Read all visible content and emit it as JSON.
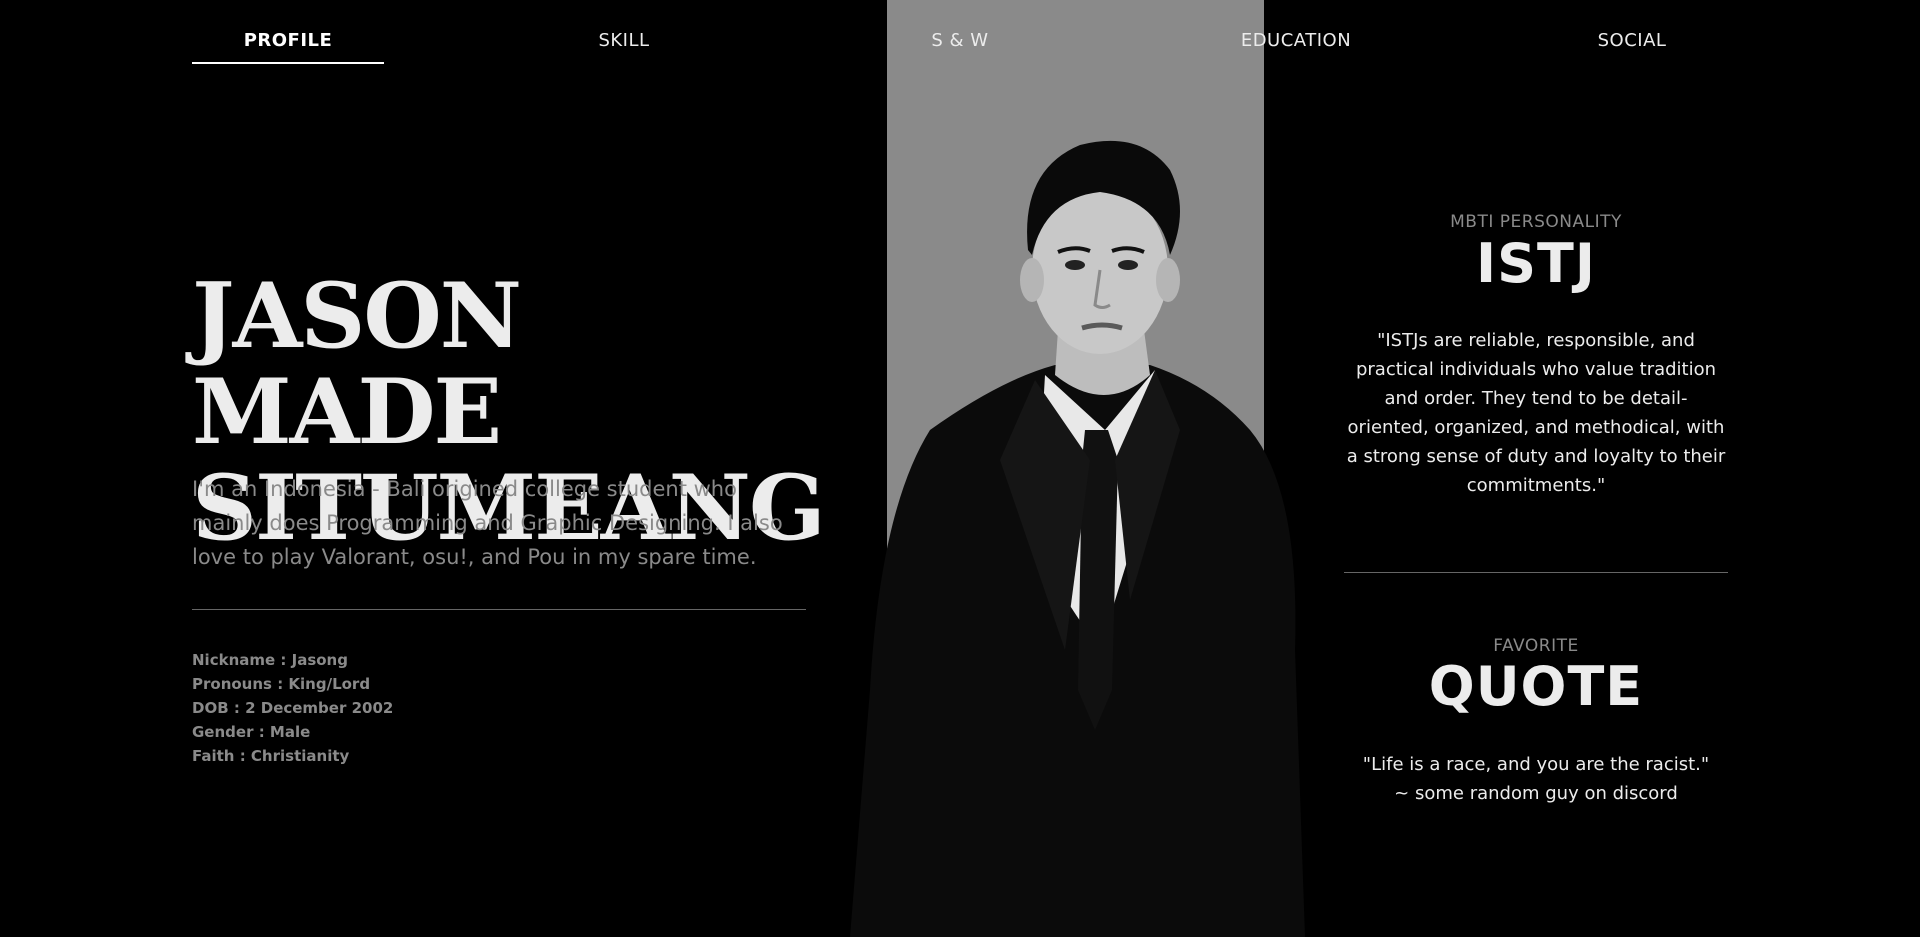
{
  "nav": {
    "items": [
      {
        "label": "PROFILE",
        "active": true
      },
      {
        "label": "SKILL",
        "active": false
      },
      {
        "label": "S & W",
        "active": false
      },
      {
        "label": "EDUCATION",
        "active": false
      },
      {
        "label": "SOCIAL",
        "active": false
      }
    ]
  },
  "profile": {
    "name_line1": "JASON MADE",
    "name_line2": "SITUMEANG",
    "intro": "I'm an Indonesia - Bali origined college student who mainly does Programming and Graphic Designing. I also love to play Valorant, osu!, and Pou in my spare time.",
    "facts": [
      "Nickname : Jasong",
      "Pronouns : King/Lord",
      "DOB : 2 December 2002",
      "Gender : Male",
      "Faith : Christianity"
    ]
  },
  "mbti": {
    "label": "MBTI PERSONALITY",
    "type": "ISTJ",
    "description": "\"ISTJs are reliable, responsible, and practical individuals who value tradition and order. They tend to be detail-oriented, organized, and methodical, with a strong sense of duty and loyalty to their commitments.\""
  },
  "quote": {
    "label": "FAVORITE",
    "title": "QUOTE",
    "text": "\"Life is a race, and you are the racist.\"",
    "author": "~ some random guy on discord"
  },
  "colors": {
    "background": "#000000",
    "band": "#8a8a8a",
    "text": "#ececec",
    "muted": "#8a8a8a"
  }
}
